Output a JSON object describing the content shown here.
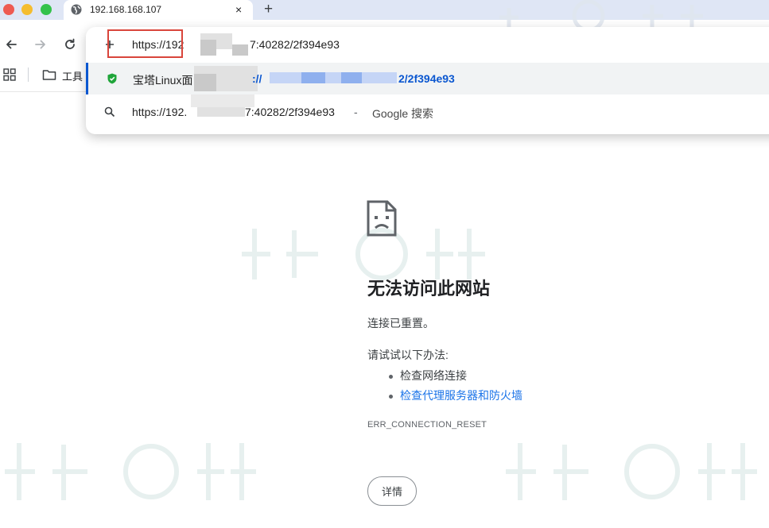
{
  "tab": {
    "title": "192.168.168.107",
    "close_glyph": "×"
  },
  "new_tab_glyph": "+",
  "bookmarks": {
    "folder_label": "工具"
  },
  "omnibox": {
    "row1": {
      "prefix": "https://192",
      "tail": "7:40282/2f394e93"
    },
    "row2": {
      "title": "宝塔Linux面",
      "url_start": "://",
      "tail": "2/2f394e93"
    },
    "row3": {
      "prefix": "https://192.",
      "tail": "7:40282/2f394e93",
      "separator": " - ",
      "engine": "Google 搜索"
    }
  },
  "error": {
    "title": "无法访问此网站",
    "subtitle": "连接已重置。",
    "try_label": "请试试以下办法:",
    "suggestions": [
      "检查网络连接",
      "检查代理服务器和防火墙"
    ],
    "code": "ERR_CONNECTION_RESET",
    "details_button": "详情"
  },
  "colors": {
    "accent": "#0b57d0",
    "link": "#1a73e8",
    "highlight_box": "#d9453b",
    "tabstrip": "#dfe6f5"
  },
  "icons": [
    "globe-icon",
    "close-icon",
    "plus-icon",
    "back-arrow-icon",
    "forward-arrow-icon",
    "reload-icon",
    "apps-grid-icon",
    "folder-icon",
    "shield-icon",
    "search-icon",
    "sad-page-icon"
  ]
}
